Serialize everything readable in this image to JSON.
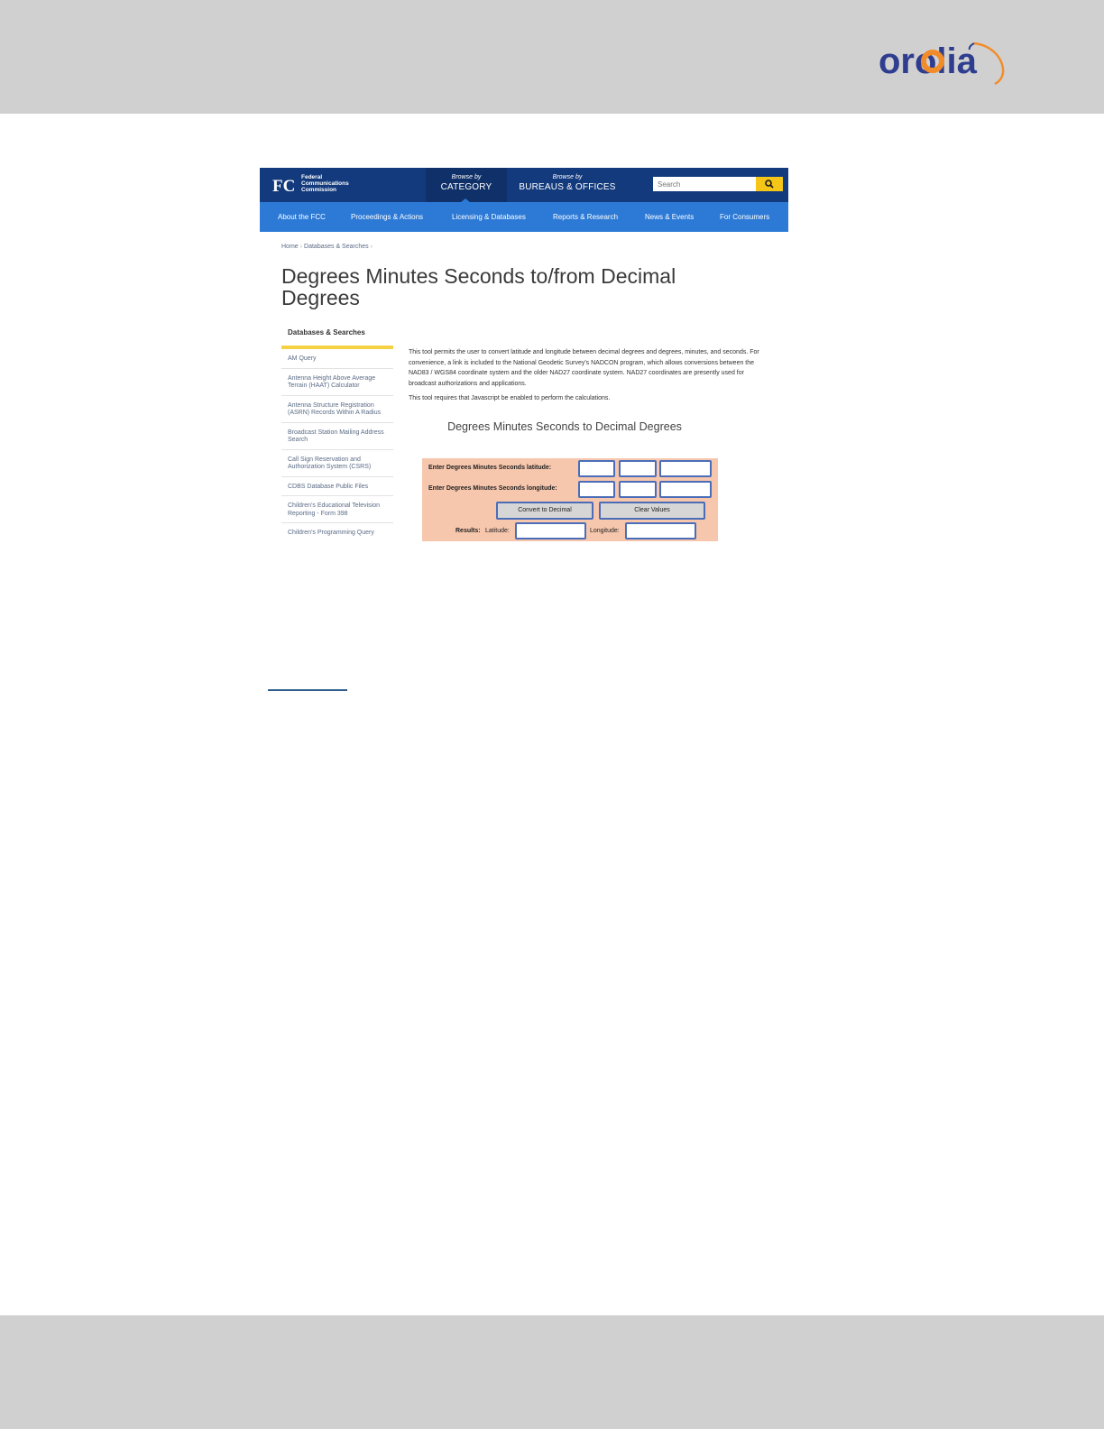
{
  "brand": {
    "logo_text": "orolia",
    "colors": {
      "logo_blue": "#2e3d8f",
      "logo_orange": "#f28c28",
      "band_gray": "#d0d0d0",
      "rule_blue": "#2d5c8a"
    }
  },
  "fcc": {
    "logo_glyph": "FCC",
    "agency_name": "Federal\nCommunications\nCommission",
    "browse_category": {
      "small": "Browse by",
      "big": "CATEGORY"
    },
    "browse_bureaus": {
      "small": "Browse by",
      "big": "BUREAUS & OFFICES"
    },
    "search_placeholder": "Search",
    "search_icon": "magnifier-icon",
    "colors": {
      "top_bar": "#133a7c",
      "nav_bar": "#2d7ad6",
      "accent": "#f5c518"
    },
    "nav": [
      "About the FCC",
      "Proceedings & Actions",
      "Licensing & Databases",
      "Reports & Research",
      "News & Events",
      "For Consumers"
    ],
    "breadcrumb": {
      "home": "Home",
      "sep": "›",
      "current": "Databases & Searches"
    },
    "title": "Degrees Minutes Seconds to/from Decimal Degrees",
    "sidebar": {
      "heading": "Databases & Searches",
      "items": [
        "AM Query",
        "Antenna Height Above Average Terrain (HAAT) Calculator",
        "Antenna Structure Registration (ASRN) Records Within A Radius",
        "Broadcast Station Mailing Address Search",
        "Call Sign Reservation and Authorization System (CSRS)",
        "CDBS Database Public Files",
        "Children's Educational Television Reporting - Form 398",
        "Children's Programming Query"
      ]
    },
    "intro": "This tool permits the user to convert latitude and longitude between decimal degrees and degrees, minutes, and seconds.  For convenience, a link is included to the National Geodetic Survey's NADCON program, which allows conversions between the NAD83 / WGS84 coordinate system and the older NAD27 coordinate system.  NAD27 coordinates are presently used for broadcast authorizations and applications.",
    "js_note": "This tool requires that Javascript be enabled to perform the calculations.",
    "converter": {
      "title": "Degrees Minutes Seconds to Decimal Degrees",
      "lat_label": "Enter Degrees Minutes Seconds latitude:",
      "lon_label": "Enter Degrees Minutes Seconds longitude:",
      "convert_button": "Convert to Decimal",
      "clear_button": "Clear Values",
      "results_label": "Results:",
      "latitude_label": "Latitude:",
      "longitude_label": "Longitude:",
      "form_color": "#f6c6ad"
    }
  }
}
